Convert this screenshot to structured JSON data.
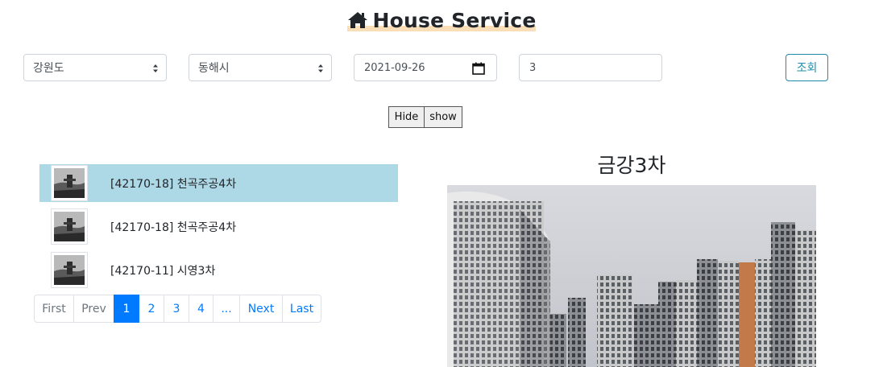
{
  "header": {
    "title": "House Service",
    "icon": "home-icon"
  },
  "filters": {
    "sido": "강원도",
    "gugun": "동해시",
    "date": "2021-09-26",
    "count": "3",
    "search_label": "조회"
  },
  "toggle": {
    "hide_label": "Hide",
    "show_label": "show"
  },
  "list": {
    "items": [
      {
        "label": "[42170-18] 천곡주공4차",
        "active": true
      },
      {
        "label": "[42170-18] 천곡주공4차",
        "active": false
      },
      {
        "label": "[42170-11] 시영3차",
        "active": false
      }
    ]
  },
  "pagination": {
    "first": "First",
    "prev": "Prev",
    "pages": [
      "1",
      "2",
      "3",
      "4"
    ],
    "ellipsis": "...",
    "next": "Next",
    "last": "Last",
    "current": "1"
  },
  "detail": {
    "title": "금강3차"
  },
  "colors": {
    "active_row": "#add8e6",
    "primary": "#007bff",
    "title_highlight": "#f9deb8"
  }
}
